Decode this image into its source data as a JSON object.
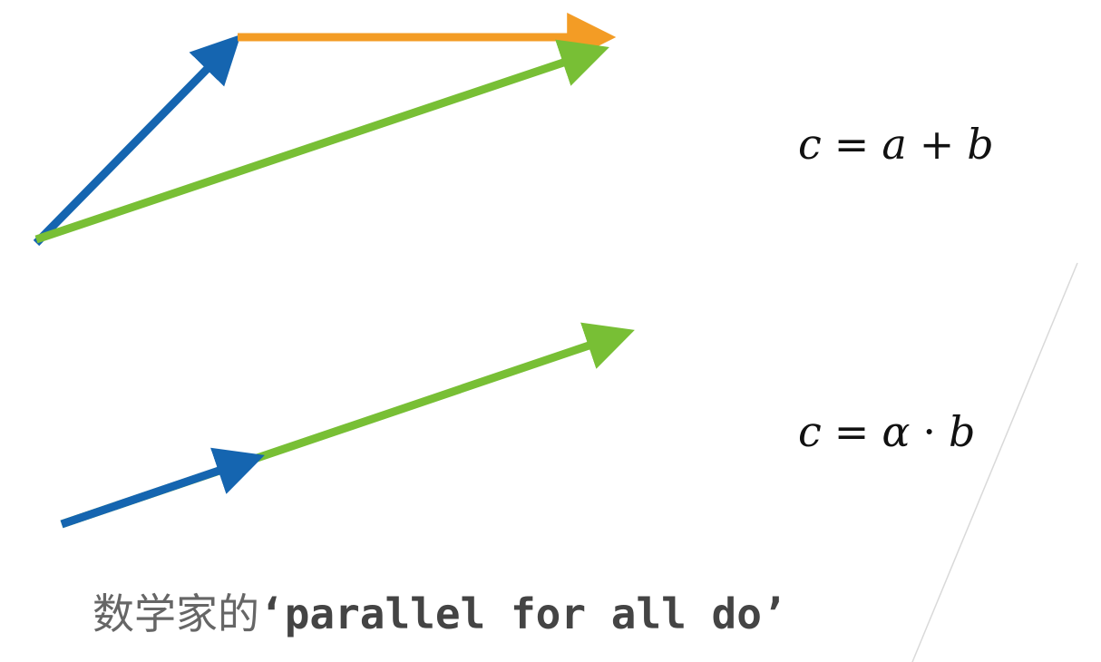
{
  "colors": {
    "vector_a": "#1565b0",
    "vector_b": "#f39c25",
    "vector_c": "#78bf35",
    "divider": "#d9d9d9"
  },
  "formulas": {
    "sum": {
      "lhs": "c",
      "eq": "=",
      "a": "a",
      "plus": "+",
      "b": "b"
    },
    "scale": {
      "lhs": "c",
      "eq": "=",
      "alpha": "α",
      "dot": "·",
      "b": "b"
    }
  },
  "caption": {
    "chinese": "数学家的",
    "code": "‘parallel for all do’"
  }
}
